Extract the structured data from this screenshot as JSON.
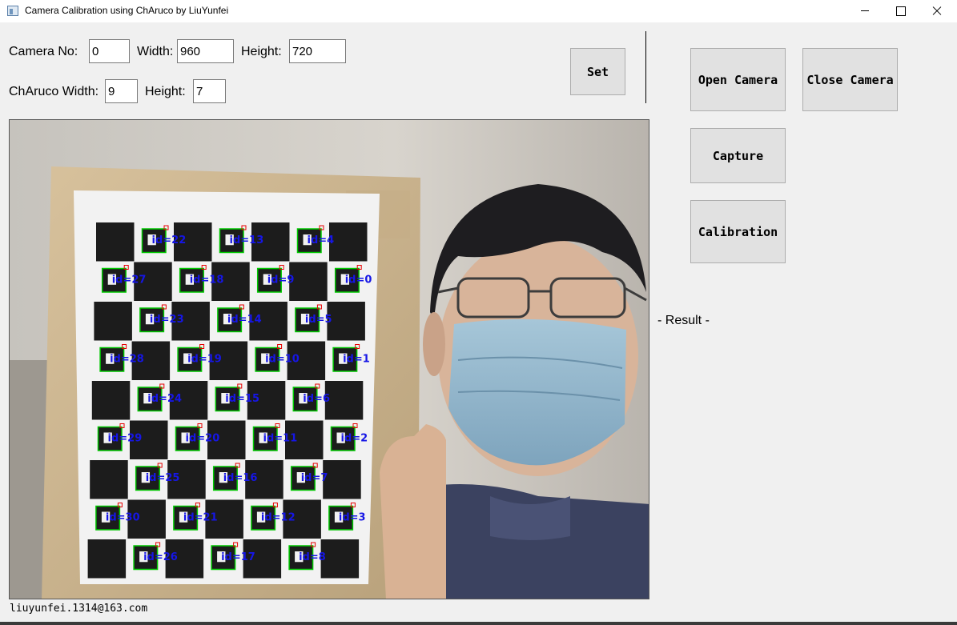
{
  "window": {
    "title": "Camera Calibration using ChAruco by LiuYunfei"
  },
  "camera_settings": {
    "camera_no_label": "Camera No:",
    "camera_no_value": "0",
    "width_label": "Width:",
    "width_value": "960",
    "height_label": "Height:",
    "height_value": "720"
  },
  "charuco_settings": {
    "width_label": "ChAruco Width:",
    "width_value": "9",
    "height_label": "Height:",
    "height_value": "7"
  },
  "buttons": {
    "set": "Set",
    "open_camera": "Open Camera",
    "close_camera": "Close Camera",
    "capture": "Capture",
    "calibration": "Calibration"
  },
  "result_label": "-  Result -",
  "status_text": "liuyunfei.1314@163.com",
  "camera_view": {
    "content": "live webcam frame of a person in a face mask holding a ChArUco calibration board with detected markers",
    "marker_labels": [
      "id=22",
      "id=13",
      "id=4",
      "id=27",
      "id=18",
      "id=9",
      "id=0",
      "id=23",
      "id=14",
      "id=5",
      "id=28",
      "id=19",
      "id=10",
      "id=1",
      "id=24",
      "id=15",
      "id=6",
      "id=29",
      "id=20",
      "id=11",
      "id=2",
      "id=25",
      "id=16",
      "id=7",
      "id=30",
      "id=21",
      "id=12",
      "id=3",
      "id=26",
      "id=17",
      "id=8"
    ],
    "marker_label_color": "#1616e6",
    "marker_outline_color": "#00c800",
    "marker_corner_color": "#e60000"
  }
}
